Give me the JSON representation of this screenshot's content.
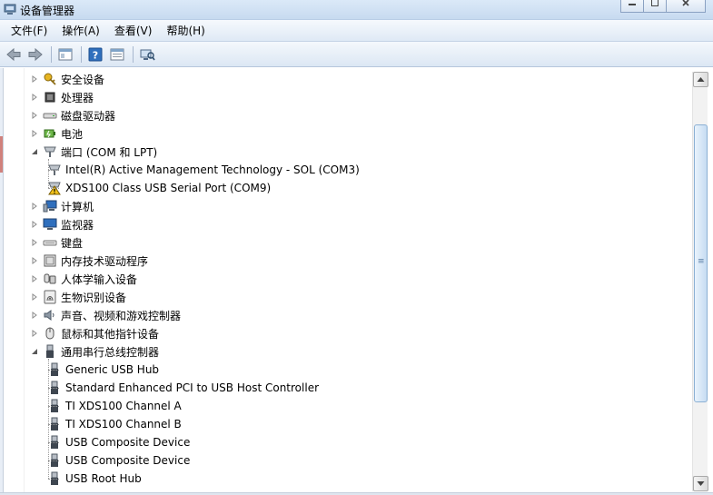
{
  "window": {
    "title": "设备管理器",
    "min_label": "▭",
    "max_label": "▢",
    "close_label": "✕"
  },
  "menu": [
    "文件(F)",
    "操作(A)",
    "查看(V)",
    "帮助(H)"
  ],
  "toolbar": {
    "buttons": [
      "back-icon",
      "forward-icon",
      "show-hide-tree-icon",
      "help-icon",
      "properties-icon",
      "scan-hardware-icon"
    ]
  },
  "tree": {
    "items": [
      {
        "label": "安全设备",
        "icon": "security-key-icon",
        "expanded": false,
        "depth": 0
      },
      {
        "label": "处理器",
        "icon": "processor-icon",
        "expanded": false,
        "depth": 0
      },
      {
        "label": "磁盘驱动器",
        "icon": "disk-drive-icon",
        "expanded": false,
        "depth": 0
      },
      {
        "label": "电池",
        "icon": "battery-icon",
        "expanded": false,
        "depth": 0
      },
      {
        "label": "端口 (COM 和 LPT)",
        "icon": "port-icon",
        "expanded": true,
        "depth": 0
      },
      {
        "label": "Intel(R) Active Management Technology - SOL (COM3)",
        "icon": "port-icon",
        "depth": 1
      },
      {
        "label": "XDS100 Class USB Serial Port (COM9)",
        "icon": "port-warning-icon",
        "depth": 1
      },
      {
        "label": "计算机",
        "icon": "computer-icon",
        "expanded": false,
        "depth": 0
      },
      {
        "label": "监视器",
        "icon": "monitor-icon",
        "expanded": false,
        "depth": 0
      },
      {
        "label": "键盘",
        "icon": "keyboard-icon",
        "expanded": false,
        "depth": 0
      },
      {
        "label": "内存技术驱动程序",
        "icon": "memory-icon",
        "expanded": false,
        "depth": 0
      },
      {
        "label": "人体学输入设备",
        "icon": "hid-icon",
        "expanded": false,
        "depth": 0
      },
      {
        "label": "生物识别设备",
        "icon": "fingerprint-icon",
        "expanded": false,
        "depth": 0
      },
      {
        "label": "声音、视频和游戏控制器",
        "icon": "speaker-icon",
        "expanded": false,
        "depth": 0
      },
      {
        "label": "鼠标和其他指针设备",
        "icon": "mouse-icon",
        "expanded": false,
        "depth": 0
      },
      {
        "label": "通用串行总线控制器",
        "icon": "usb-icon",
        "expanded": true,
        "depth": 0
      },
      {
        "label": "Generic USB Hub",
        "icon": "usb-icon",
        "depth": 1
      },
      {
        "label": "Standard Enhanced PCI to USB Host Controller",
        "icon": "usb-icon",
        "depth": 1
      },
      {
        "label": "TI XDS100 Channel A",
        "icon": "usb-icon",
        "depth": 1
      },
      {
        "label": "TI XDS100 Channel B",
        "icon": "usb-icon",
        "depth": 1
      },
      {
        "label": "USB Composite Device",
        "icon": "usb-icon",
        "depth": 1
      },
      {
        "label": "USB Composite Device",
        "icon": "usb-icon",
        "depth": 1
      },
      {
        "label": "USB Root Hub",
        "icon": "usb-icon",
        "depth": 1
      }
    ]
  },
  "scrollbar": {
    "grip": "≡"
  }
}
